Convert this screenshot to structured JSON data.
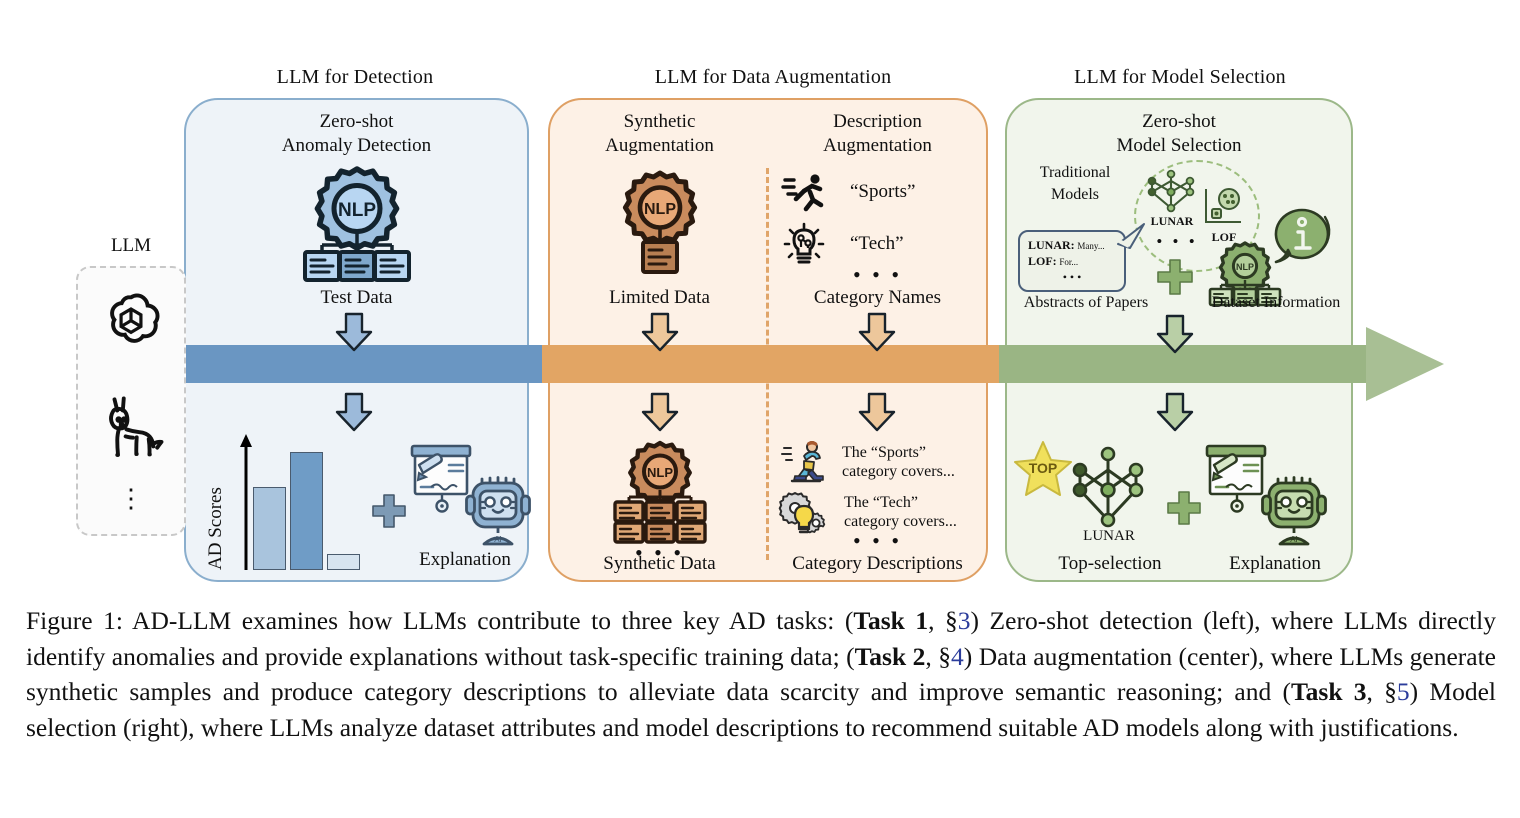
{
  "figure": {
    "columns": [
      {
        "id": "detection",
        "title": "LLM for Detection",
        "accent": "#6a96c2",
        "panel_bg": "#eef3f8",
        "panel_border": "#8aaecd"
      },
      {
        "id": "augmentation",
        "title": "LLM for Data Augmentation",
        "accent": "#e2a564",
        "panel_bg": "#fdf1e6",
        "panel_border": "#dfa064"
      },
      {
        "id": "selection",
        "title": "LLM for Model Selection",
        "accent": "#9ab584",
        "panel_bg": "#f1f5ec",
        "panel_border": "#9cb889"
      }
    ],
    "llm_source": {
      "label": "LLM",
      "icons": [
        "openai-logo-icon",
        "llama-icon"
      ],
      "ellipsis": "⋮"
    },
    "detection": {
      "heading_line1": "Zero-shot",
      "heading_line2": "Anomaly Detection",
      "gear_label": "NLP",
      "input_label": "Test Data",
      "output_axis_label": "AD Scores",
      "output_label": "Explanation",
      "plus": "+"
    },
    "synthetic": {
      "heading_line1": "Synthetic",
      "heading_line2": "Augmentation",
      "gear_label": "NLP",
      "input_label": "Limited Data",
      "output_label": "Synthetic Data",
      "ellipsis": "• • •"
    },
    "description": {
      "heading_line1": "Description",
      "heading_line2": "Augmentation",
      "categories": [
        {
          "icon": "running-person-icon",
          "text": "“Sports”"
        },
        {
          "icon": "lightbulb-circuit-icon",
          "text": "“Tech”"
        }
      ],
      "ellipsis": "• • •",
      "input_label": "Category Names",
      "descriptions": [
        {
          "icon": "runner-color-icon",
          "line1": "The “Sports”",
          "line2": "category covers..."
        },
        {
          "icon": "bulb-gears-icon",
          "line1": "The “Tech”",
          "line2": "category covers..."
        }
      ],
      "output_label": "Category Descriptions"
    },
    "selection": {
      "heading_line1": "Zero-shot",
      "heading_line2": "Model Selection",
      "traditional_label_line1": "Traditional",
      "traditional_label_line2": "Models",
      "models": [
        "LUNAR",
        "LOF"
      ],
      "models_ellipsis": "• • •",
      "bubble_lines": [
        {
          "name": "LUNAR:",
          "text": "Many..."
        },
        {
          "name": "LOF:",
          "text": "For..."
        }
      ],
      "bubble_ellipsis": "• • •",
      "abstracts_label": "Abstracts of Papers",
      "dataset_label": "Dataset Information",
      "dataset_gear_label": "NLP",
      "info_icon_glyph": "i",
      "plus": "+",
      "star_label": "TOP",
      "selected_model": "LUNAR",
      "output_label_left": "Top-selection",
      "output_label_right": "Explanation"
    },
    "caption": {
      "prefix": "Figure 1: AD-LLM examines how LLMs contribute to three key AD tasks: (",
      "t1": "Task 1",
      "s1_sep": ", §",
      "s1": "3",
      "p1": ") Zero-shot detection (left), where LLMs directly identify anomalies and provide explanations without task-specific training data; (",
      "t2": "Task 2",
      "s2": "4",
      "p2": ") Data augmentation (center), where LLMs generate synthetic samples and produce category descriptions to alleviate data scarcity and improve semantic reasoning; and (",
      "t3": "Task 3",
      "s3": "5",
      "p3": ") Model selection (right), where LLMs analyze dataset attributes and model descriptions to recommend suitable AD models along with justifications."
    }
  }
}
